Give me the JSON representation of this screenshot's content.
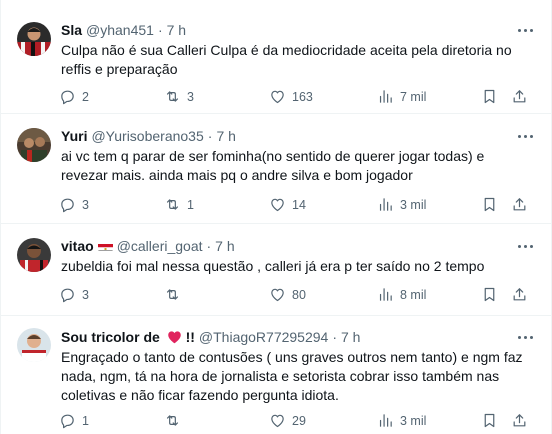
{
  "colors": {
    "text": "#0f1419",
    "muted": "#536471",
    "border": "#eff3f4",
    "heart": "#f91880"
  },
  "tweets": [
    {
      "name": "Sla",
      "handle": "@yhan451",
      "dot": "·",
      "time": "7 h",
      "text": "Culpa não é sua Calleri Culpa é da mediocridade aceita pela diretoria no reffis e preparação",
      "replies": "2",
      "retweets": "3",
      "likes": "163",
      "views": "7 mil"
    },
    {
      "name": "Yuri",
      "handle": "@Yurisoberano35",
      "dot": "·",
      "time": "7 h",
      "text": "ai vc tem q parar de ser fominha(no sentido de querer jogar todas) e revezar mais. ainda mais pq o andre silva e bom jogador",
      "replies": "3",
      "retweets": "1",
      "likes": "14",
      "views": "3 mil"
    },
    {
      "name": "vitao",
      "handle": "@calleri_goat",
      "dot": "·",
      "time": "7 h",
      "text": "zubeldia foi mal nessa questão , calleri já era p ter saído no 2 tempo",
      "replies": "3",
      "retweets": "",
      "likes": "80",
      "views": "8 mil"
    },
    {
      "name_pre": "Sou tricolor de",
      "name_post": "!!",
      "handle": "@ThiagoR77295294",
      "dot": "·",
      "time": "7 h",
      "text": "Engraçado o tanto de contusões ( uns graves outros nem tanto) e ngm faz nada, ngm, tá na hora de jornalista e setorista cobrar isso também nas coletivas e não ficar fazendo pergunta idiota.",
      "replies": "1",
      "retweets": "",
      "likes": "29",
      "views": "3 mil"
    }
  ]
}
